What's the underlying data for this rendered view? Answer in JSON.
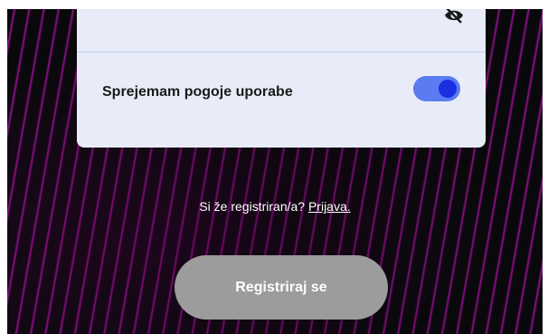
{
  "card": {
    "password_visibility_icon": "eye-off-icon",
    "terms_label": "Sprejemam pogoje uporabe",
    "terms_accepted": true
  },
  "login_prompt": {
    "text": "Si že registriran/a?",
    "link": "Prijava."
  },
  "register_button": {
    "label": "Registriraj se"
  },
  "colors": {
    "card_bg": "#e8ecf8",
    "toggle_track": "#5b7cf0",
    "toggle_knob": "#1a2fe0",
    "button_bg": "#9c9c9c",
    "background_accent": "#b01aa8"
  }
}
